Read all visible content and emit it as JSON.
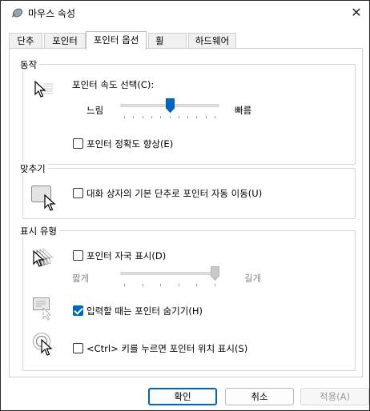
{
  "window": {
    "title": "마우스 속성",
    "close_glyph": "✕"
  },
  "tabs": [
    {
      "label": "단추"
    },
    {
      "label": "포인터"
    },
    {
      "label": "포인터 옵션",
      "active": true
    },
    {
      "label": "휠"
    },
    {
      "label": "하드웨어"
    }
  ],
  "motion": {
    "group_label": "동작",
    "speed_label": "포인터 속도 선택(C):",
    "slow_label": "느림",
    "fast_label": "빠름",
    "speed_value_fraction": 0.5,
    "precision_label": "포인터 정확도 향상(E)",
    "precision_checked": false
  },
  "snap_to": {
    "group_label": "맞추기",
    "label": "대화 상자의 기본 단추로 포인터 자동 이동(U)",
    "checked": false
  },
  "visibility": {
    "group_label": "표시 유형",
    "trails_label": "포인터 자국 표시(D)",
    "trails_checked": false,
    "short_label": "짧게",
    "long_label": "길게",
    "trails_value_fraction": 1.0,
    "hide_typing_label": "입력할 때는 포인터 숨기기(H)",
    "hide_typing_checked": true,
    "ctrl_label": "<Ctrl> 키를 누르면 포인터 위치 표시(S)",
    "ctrl_checked": false
  },
  "buttons": {
    "ok": "확인",
    "cancel": "취소",
    "apply": "적용(A)"
  },
  "colors": {
    "accent": "#0067c0"
  }
}
